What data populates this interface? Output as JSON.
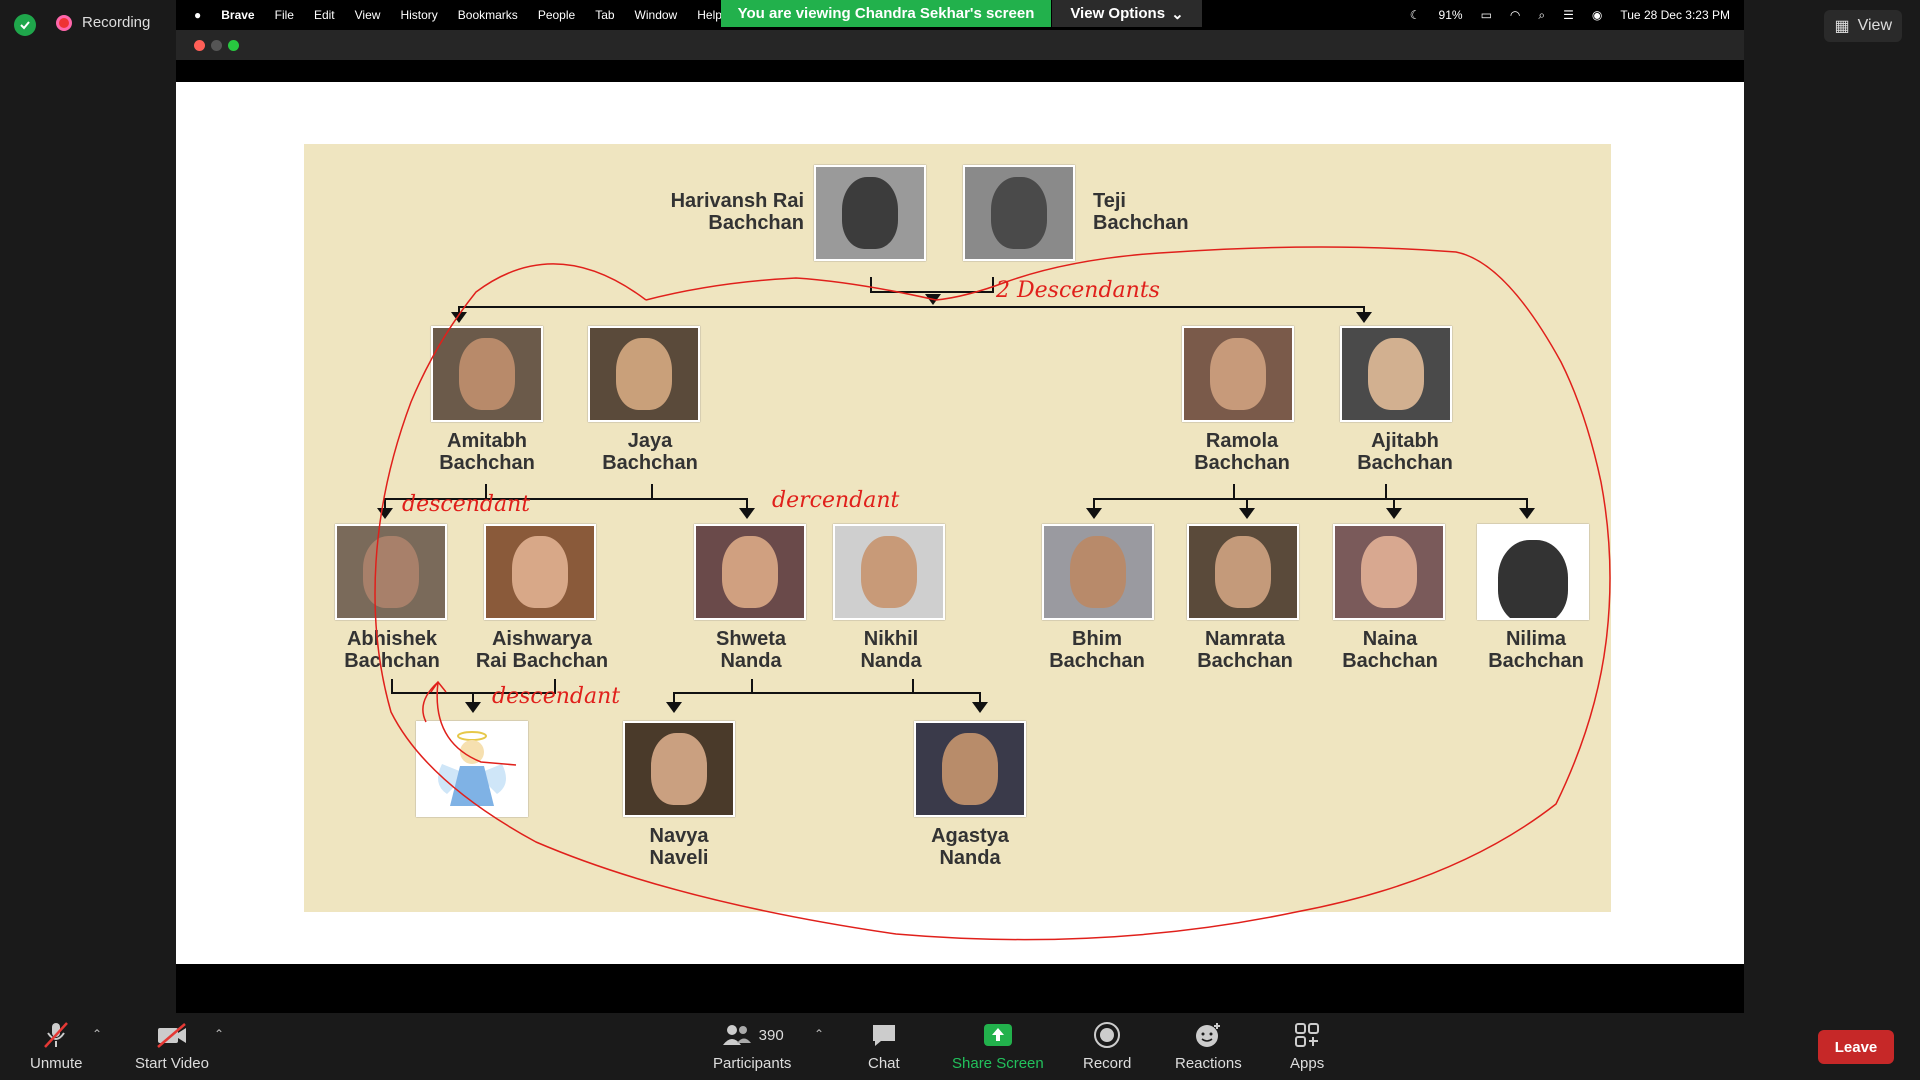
{
  "zoom": {
    "recording_label": "Recording",
    "view_label": "View",
    "banner_text": "You are viewing Chandra Sekhar's screen",
    "view_options_label": "View Options",
    "toolbar": {
      "unmute": "Unmute",
      "start_video": "Start Video",
      "participants_count": "390",
      "participants": "Participants",
      "chat": "Chat",
      "share_screen": "Share Screen",
      "record": "Record",
      "reactions": "Reactions",
      "apps": "Apps",
      "leave": "Leave"
    }
  },
  "mac_menu": {
    "items": [
      "Brave",
      "File",
      "Edit",
      "View",
      "History",
      "Bookmarks",
      "People",
      "Tab",
      "Window",
      "Help"
    ],
    "battery": "91%",
    "datetime": "Tue 28 Dec  3:23 PM"
  },
  "tree": {
    "people": {
      "harivansh": "Harivansh Rai\nBachchan",
      "teji": "Teji\nBachchan",
      "amitabh": "Amitabh\nBachchan",
      "jaya": "Jaya\nBachchan",
      "ramola": "Ramola\nBachchan",
      "ajitabh": "Ajitabh\nBachchan",
      "abhishek": "Abhishek\nBachchan",
      "aishwarya": "Aishwarya\nRai Bachchan",
      "shweta": "Shweta\nNanda",
      "nikhil": "Nikhil\nNanda",
      "bhim": "Bhim\nBachchan",
      "namrata": "Namrata\nBachchan",
      "naina": "Naina\nBachchan",
      "nilima": "Nilima\nBachchan",
      "navya": "Navya\nNaveli",
      "agastya": "Agastya\nNanda"
    },
    "annotations": {
      "top": "2 Descendants",
      "left": "descendant",
      "middle": "dercendant",
      "bottom": "descendant"
    }
  }
}
